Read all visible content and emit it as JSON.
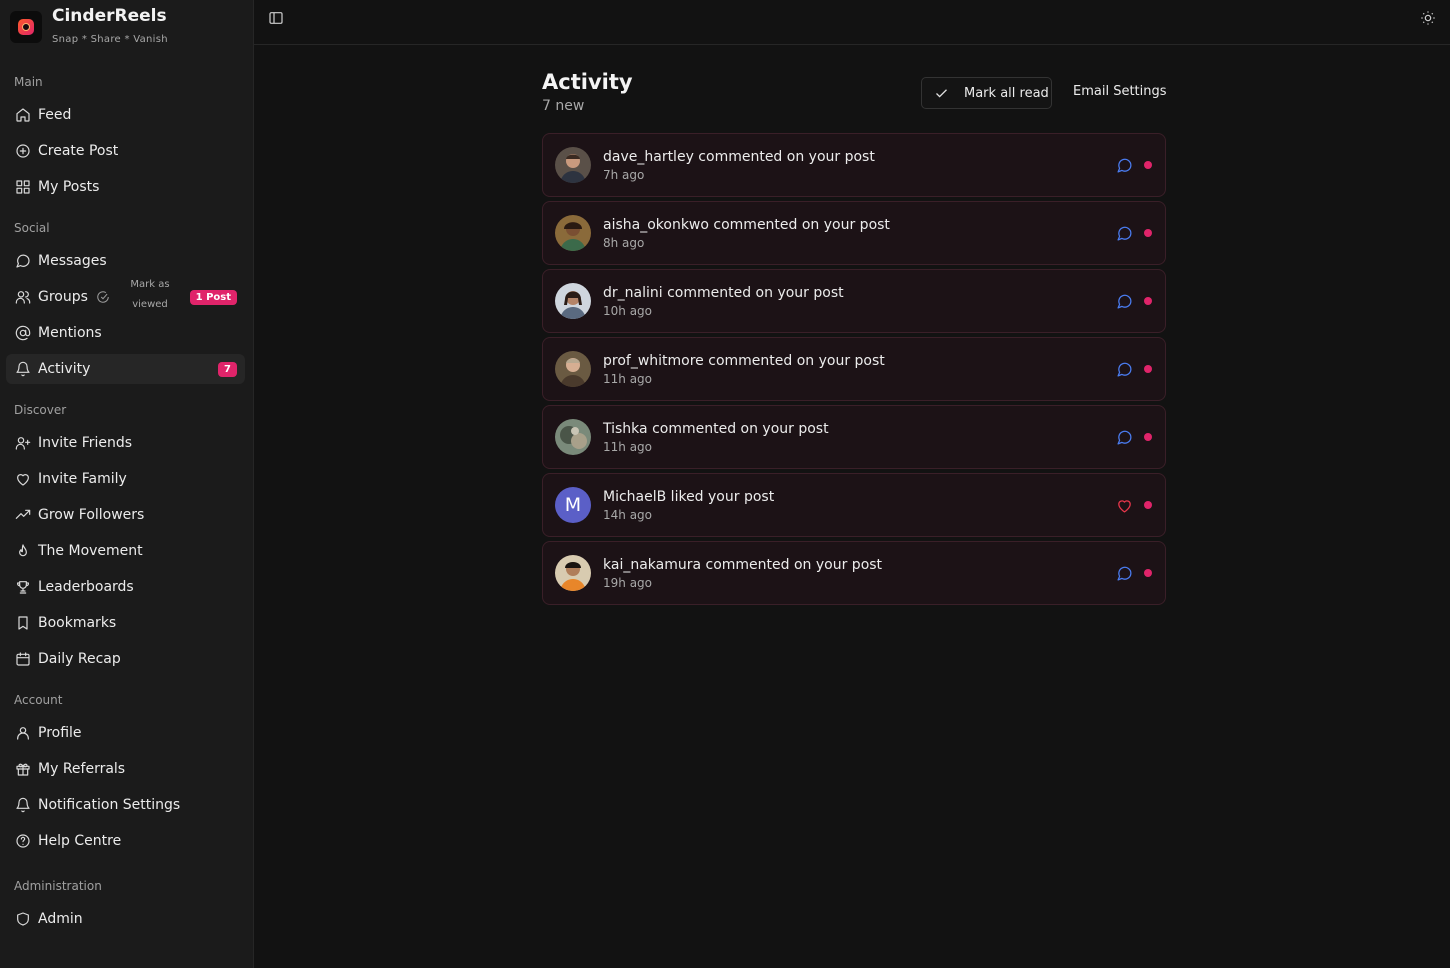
{
  "brand": {
    "name": "CinderReels",
    "tagline": "Snap * Share * Vanish"
  },
  "colors": {
    "accent": "#e0246a",
    "comment_icon": "#4a7cf0",
    "like_icon": "#e8364b",
    "letter_avatar": "#5b5fc7"
  },
  "sidebar": {
    "sections": {
      "main": "Main",
      "social": "Social",
      "discover": "Discover",
      "account": "Account",
      "administration": "Administration"
    },
    "items": {
      "feed": "Feed",
      "create_post": "Create Post",
      "my_posts": "My Posts",
      "messages": "Messages",
      "groups": "Groups",
      "groups_mark_line1": "Mark as",
      "groups_mark_line2": "viewed",
      "groups_badge": "1 Post",
      "mentions": "Mentions",
      "activity": "Activity",
      "activity_badge": "7",
      "invite_friends": "Invite Friends",
      "invite_family": "Invite Family",
      "grow_followers": "Grow Followers",
      "the_movement": "The Movement",
      "leaderboards": "Leaderboards",
      "bookmarks": "Bookmarks",
      "daily_recap": "Daily Recap",
      "profile": "Profile",
      "my_referrals": "My Referrals",
      "notification_settings": "Notification Settings",
      "help_centre": "Help Centre",
      "admin": "Admin"
    }
  },
  "main": {
    "title": "Activity",
    "subtitle": "7 new",
    "mark_all_read": "Mark all read",
    "email_settings": "Email Settings",
    "activities": [
      {
        "text": "dave_hartley commented on your post",
        "time": "7h ago",
        "icon": "comment-icon",
        "avatar": "photo"
      },
      {
        "text": "aisha_okonkwo commented on your post",
        "time": "8h ago",
        "icon": "comment-icon",
        "avatar": "photo"
      },
      {
        "text": "dr_nalini commented on your post",
        "time": "10h ago",
        "icon": "comment-icon",
        "avatar": "photo"
      },
      {
        "text": "prof_whitmore commented on your post",
        "time": "11h ago",
        "icon": "comment-icon",
        "avatar": "photo"
      },
      {
        "text": "Tishka commented on your post",
        "time": "11h ago",
        "icon": "comment-icon",
        "avatar": "photo"
      },
      {
        "text": "MichaelB liked your post",
        "time": "14h ago",
        "icon": "heart-icon",
        "avatar": "M"
      },
      {
        "text": "kai_nakamura commented on your post",
        "time": "19h ago",
        "icon": "comment-icon",
        "avatar": "photo"
      }
    ]
  }
}
